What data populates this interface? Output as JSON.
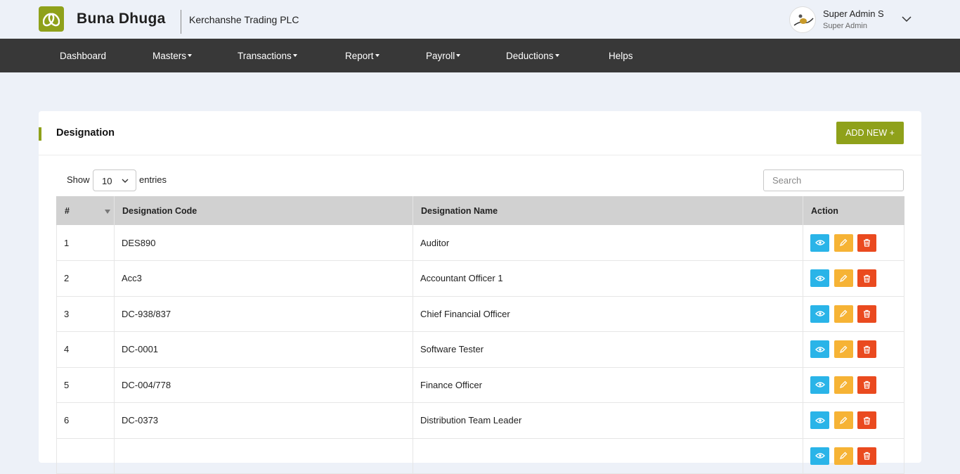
{
  "header": {
    "brand": "Buna Dhuga",
    "company": "Kerchanshe Trading PLC",
    "user_name": "Super Admin S",
    "user_role": "Super Admin",
    "accent_color": "#8fa11a"
  },
  "nav": {
    "dashboard": "Dashboard",
    "masters": "Masters",
    "transactions": "Transactions",
    "report": "Report",
    "payroll": "Payroll",
    "deductions": "Deductions",
    "helps": "Helps"
  },
  "card": {
    "title": "Designation",
    "add_button": "ADD NEW +"
  },
  "table_controls": {
    "show_label": "Show",
    "entries_value": "10",
    "entries_label": "entries",
    "search_placeholder": "Search"
  },
  "table": {
    "headers": [
      "#",
      "Designation Code",
      "Designation Name",
      "Action"
    ],
    "rows": [
      {
        "num": "1",
        "code": "DES890",
        "name": "Auditor"
      },
      {
        "num": "2",
        "code": "Acc3",
        "name": "Accountant Officer 1"
      },
      {
        "num": "3",
        "code": "DC-938/837",
        "name": "Chief Financial Officer"
      },
      {
        "num": "4",
        "code": "DC-0001",
        "name": "Software Tester"
      },
      {
        "num": "5",
        "code": "DC-004/778",
        "name": "Finance Officer"
      },
      {
        "num": "6",
        "code": "DC-0373",
        "name": "Distribution Team Leader"
      },
      {
        "num": "",
        "code": "",
        "name": ""
      }
    ]
  }
}
